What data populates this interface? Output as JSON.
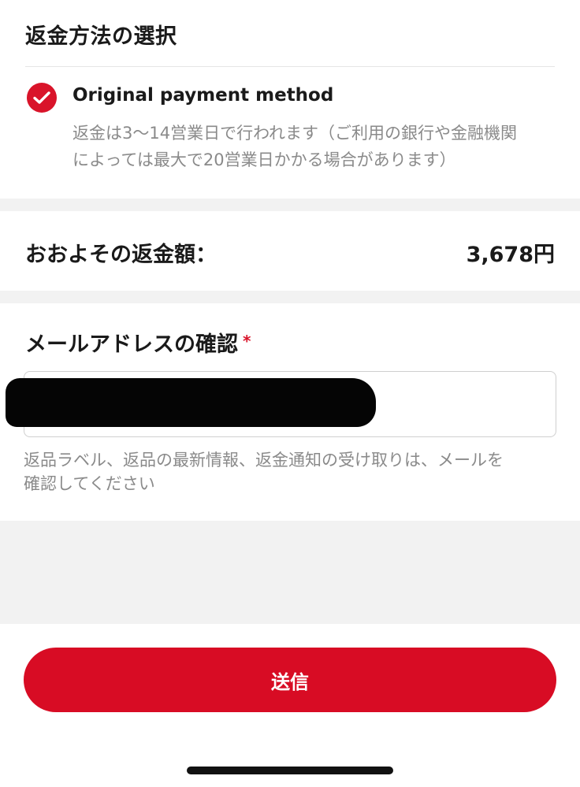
{
  "refund_method": {
    "title": "返金方法の選択",
    "option_label": "Original payment method",
    "option_note_line1": "返金は3〜14営業日で行われます（ご利用の銀行や金融機関",
    "option_note_line2": "によっては最大で20営業日かかる場合があります）",
    "selected": true
  },
  "refund_amount": {
    "label": "おおよその返金額：",
    "value": "3,678円"
  },
  "email_confirm": {
    "title": "メールアドレスの確認",
    "required_mark": "*",
    "help_line1": "返品ラベル、返品の最新情報、返金通知の受け取りは、メールを",
    "help_line2": "確認してください"
  },
  "submit": {
    "label": "送信"
  },
  "colors": {
    "accent": "#d80c24",
    "muted_text": "#8a8a8a",
    "section_gap": "#f2f2f2"
  }
}
